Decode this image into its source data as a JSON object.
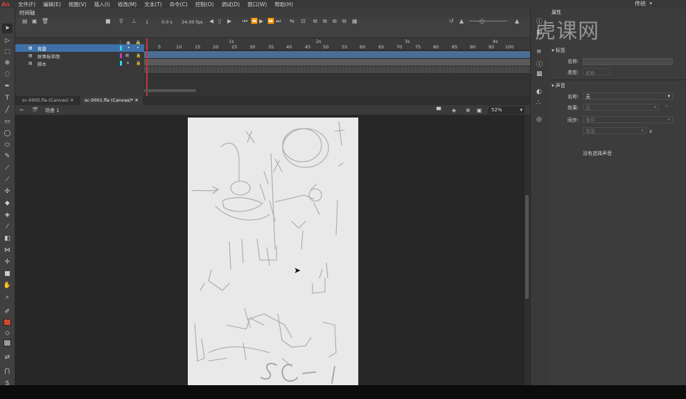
{
  "app": {
    "logo": "An"
  },
  "menu": [
    "文件(F)",
    "编辑(E)",
    "视图(V)",
    "插入(I)",
    "修改(M)",
    "文本(T)",
    "命令(C)",
    "控制(O)",
    "调试(D)",
    "窗口(W)",
    "帮助(H)"
  ],
  "workspace": "传统",
  "timeline": {
    "tab": "时间轴",
    "current_frame": "1",
    "time": "0.0 s",
    "fps": "24.00 fps",
    "seconds": [
      "1s",
      "2s",
      "3s",
      "4s"
    ],
    "frame_ticks": [
      "1",
      "5",
      "10",
      "15",
      "20",
      "25",
      "30",
      "35",
      "40",
      "45",
      "50",
      "55",
      "60",
      "65",
      "70",
      "75",
      "80",
      "85",
      "90",
      "95",
      "100"
    ],
    "layers": [
      {
        "name": "背景",
        "selected": true,
        "color": "#2bd9e8"
      },
      {
        "name": "故事板草图",
        "selected": false,
        "color": "#b042d6"
      },
      {
        "name": "脚本",
        "selected": false,
        "color": "#2bd9e8"
      }
    ]
  },
  "doc_tabs": [
    {
      "label": "sc-0005.fla (Canvas)",
      "active": false
    },
    {
      "label": "sc-0001.fla (Canvas)*",
      "active": true
    }
  ],
  "scene": {
    "label": "场景 1",
    "zoom": "52%"
  },
  "properties": {
    "tab": "属性",
    "label_section": "标签",
    "name_label": "名称:",
    "name_placeholder": "",
    "type_label": "类型:",
    "type_value": "名称",
    "sound_section": "声音",
    "sound_name_label": "名称:",
    "sound_name_value": "无",
    "effect_label": "效果:",
    "effect_value": "无",
    "sync_label": "同步:",
    "sync_value": "事件",
    "repeat_value": "重复",
    "repeat_x": "x",
    "no_sound": "没有选择声音"
  },
  "watermark": "虎课网",
  "colors": {
    "stroke": "#d04a2a",
    "fill": "#9a9a9a"
  }
}
